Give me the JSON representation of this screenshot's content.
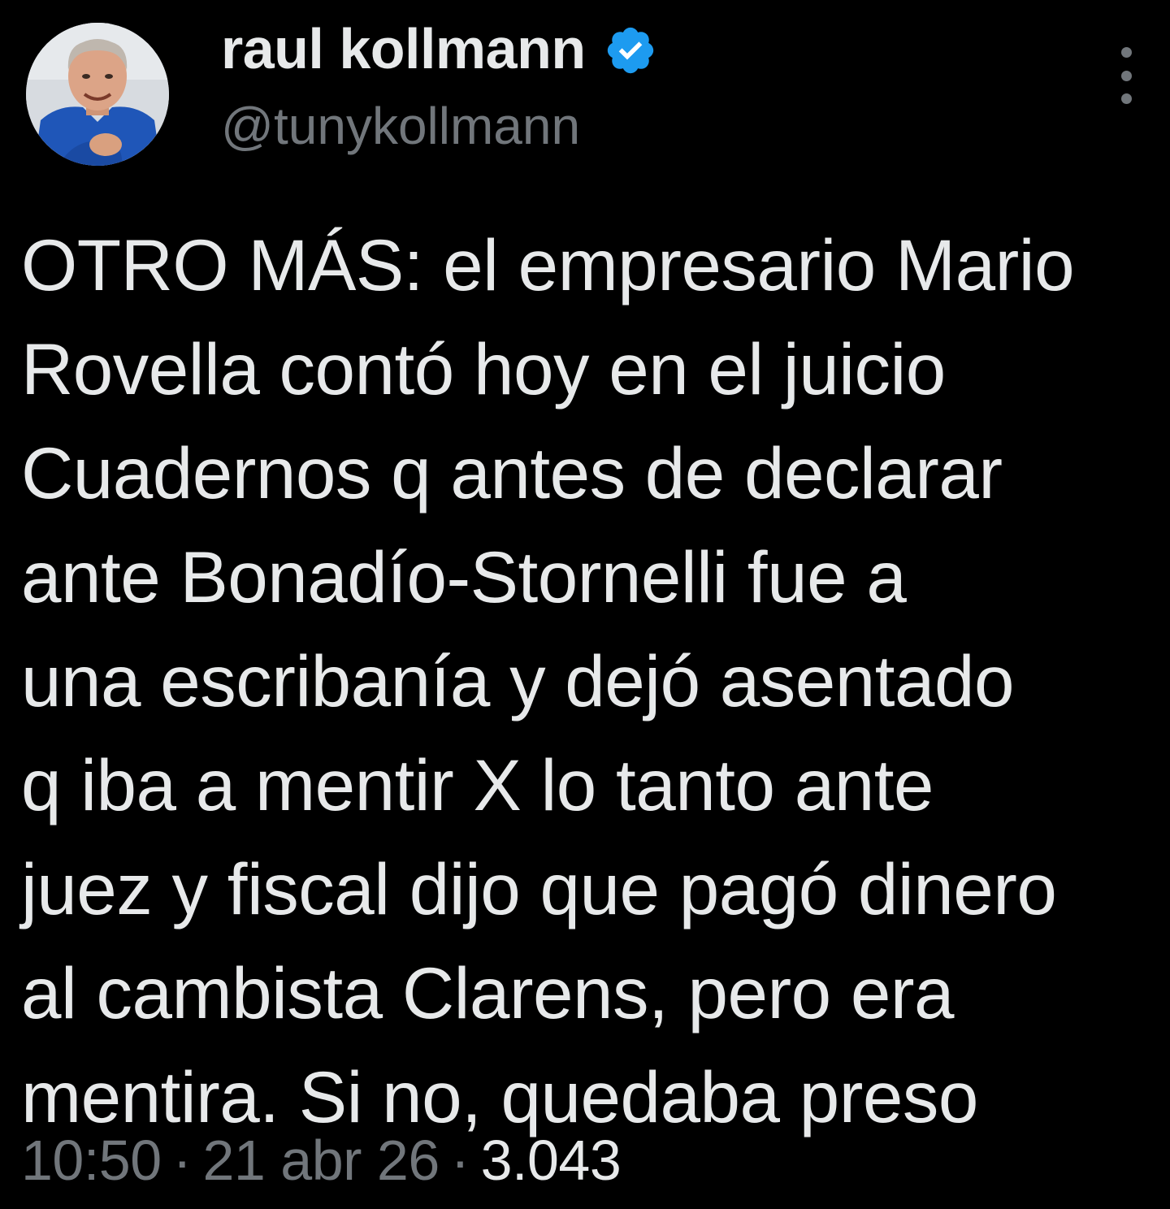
{
  "author": {
    "display_name": "raul kollmann",
    "handle": "@tunykollmann",
    "verified": true,
    "avatar": "profile-photo",
    "verified_icon": "verified-badge-icon"
  },
  "colors": {
    "background": "#000000",
    "text": "#e7e9ea",
    "secondary": "#71767b",
    "verified_blue": "#1d9bf0"
  },
  "more_icon": "more-options-icon",
  "tweet": {
    "lines": [
      "OTRO MÁS: el empresario Mario",
      "Rovella contó hoy en el juicio",
      "Cuadernos q antes de declarar",
      "ante Bonadío-Stornelli fue a",
      "una escribanía y dejó asentado",
      "q iba a mentir X lo tanto ante",
      "juez y fiscal dijo que pagó dinero",
      "al cambista Clarens, pero era",
      "mentira. Si no, quedaba preso"
    ]
  },
  "meta": {
    "time": "10:50",
    "separator": "·",
    "date": "21 abr 26",
    "views": "3.043"
  }
}
